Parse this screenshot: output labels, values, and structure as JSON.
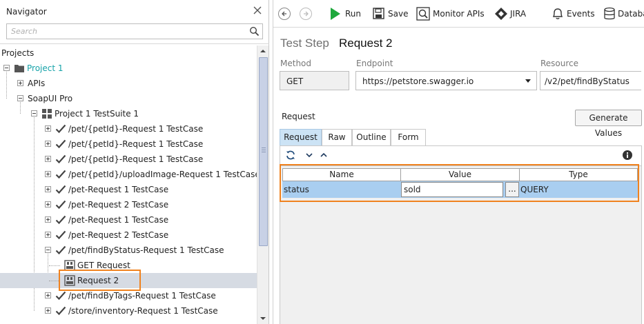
{
  "navigator": {
    "title": "Navigator",
    "search_placeholder": "Search",
    "projects_label": "Projects",
    "tree": [
      {
        "label": "Project 1",
        "depth": 0,
        "icon": "folder-icon",
        "expander": "minus",
        "teal": true
      },
      {
        "label": "APIs",
        "depth": 1,
        "icon": "",
        "expander": "plus"
      },
      {
        "label": "SoapUI Pro",
        "depth": 1,
        "icon": "",
        "expander": "minus"
      },
      {
        "label": "Project 1 TestSuite 1",
        "depth": 2,
        "icon": "testsuite-icon",
        "expander": "minus"
      },
      {
        "label": "/pet/{petId}-Request 1 TestCase",
        "depth": 3,
        "icon": "check-icon",
        "expander": "plus"
      },
      {
        "label": "/pet/{petId}-Request 1 TestCase",
        "depth": 3,
        "icon": "check-icon",
        "expander": "plus"
      },
      {
        "label": "/pet/{petId}-Request 1 TestCase",
        "depth": 3,
        "icon": "check-icon",
        "expander": "plus"
      },
      {
        "label": "/pet/{petId}/uploadImage-Request 1 TestCase",
        "depth": 3,
        "icon": "check-icon",
        "expander": "plus"
      },
      {
        "label": "/pet-Request 1 TestCase",
        "depth": 3,
        "icon": "check-icon",
        "expander": "plus"
      },
      {
        "label": "/pet-Request 2 TestCase",
        "depth": 3,
        "icon": "check-icon",
        "expander": "plus"
      },
      {
        "label": "/pet-Request 1 TestCase",
        "depth": 3,
        "icon": "check-icon",
        "expander": "plus"
      },
      {
        "label": "/pet-Request 2 TestCase",
        "depth": 3,
        "icon": "check-icon",
        "expander": "plus"
      },
      {
        "label": "/pet/findByStatus-Request 1 TestCase",
        "depth": 3,
        "icon": "check-icon",
        "expander": "minus"
      },
      {
        "label": "GET Request",
        "depth": 4,
        "icon": "request-step-icon",
        "expander": ""
      },
      {
        "label": "Request 2",
        "depth": 4,
        "icon": "request-step-icon",
        "expander": "",
        "selected": true
      },
      {
        "label": "/pet/findByTags-Request 1 TestCase",
        "depth": 3,
        "icon": "check-icon",
        "expander": "plus"
      },
      {
        "label": "/store/inventory-Request 1 TestCase",
        "depth": 3,
        "icon": "check-icon",
        "expander": "plus"
      }
    ]
  },
  "toolbar": {
    "run": "Run",
    "save": "Save",
    "monitor": "Monitor APIs",
    "jira": "JIRA",
    "events": "Events",
    "database": "Databa"
  },
  "step": {
    "kind": "Test Step",
    "name": "Request 2"
  },
  "fields": {
    "method_label": "Method",
    "method_value": "GET",
    "endpoint_label": "Endpoint",
    "endpoint_value": "https://petstore.swagger.io",
    "resource_label": "Resource",
    "resource_value": "/v2/pet/findByStatus"
  },
  "request": {
    "section_label": "Request",
    "generate_button": "Generate Values",
    "tabs": [
      "Request",
      "Raw",
      "Outline",
      "Form"
    ],
    "active_tab": "Request",
    "columns": [
      "Name",
      "Value",
      "Type"
    ],
    "rows": [
      {
        "name": "status",
        "value": "sold",
        "type": "QUERY",
        "browse": "..."
      }
    ]
  },
  "colors": {
    "highlight": "#f0821e",
    "teal_project": "#17a3a9",
    "run_green": "#1ea83c",
    "row_selected": "#a9cef0"
  }
}
